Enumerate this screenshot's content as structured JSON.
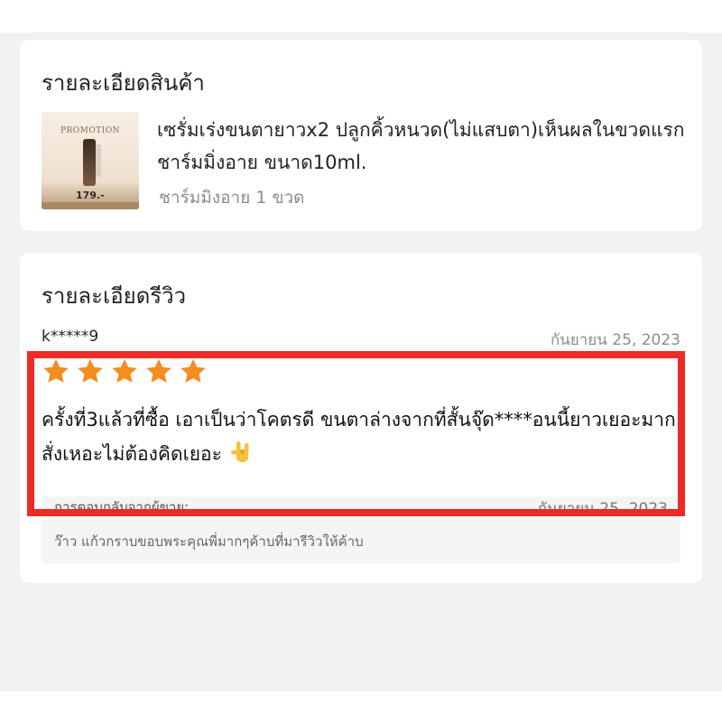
{
  "product_section": {
    "title": "รายละเอียดสินค้า",
    "thumbnail": {
      "promo_text": "PROMOTION",
      "price_text": "179.-"
    },
    "product_name": "เซรั่มเร่งขนตายาวx2 ปลูกคิ้วหนวด(ไม่แสบตา)เห็นผลในขวดแรก ชาร์มมิ่งอาย ขนาด10ml.",
    "variant": "ชาร์มมิงอาย 1 ขวด"
  },
  "review_section": {
    "title": "รายละเอียดรีวิว",
    "reviewer": "k*****9",
    "date": "กันยายน 25, 2023",
    "rating": 5,
    "star_color": "#f48c1e",
    "review_text": "ครั้งที่3แล้วที่ซื้อ เอาเป็นว่าโคตรดี ขนตาล่างจากที่สั้นจุ๊ด****อนนี้ยาวเยอะมาก สั่งเหอะไม่ต้องคิดเยอะ",
    "review_emoji": "hand-rock-emoji",
    "seller_reply": {
      "label": "การตอบกลับจากผู้ขาย:",
      "date": "กันยายน 25, 2023",
      "text": "ว๊าว แก้วกราบขอบพระคุณพี่มากๆค้าบที่มารีวิวให้ค้าบ"
    }
  },
  "highlight_color": "#ee2a26"
}
